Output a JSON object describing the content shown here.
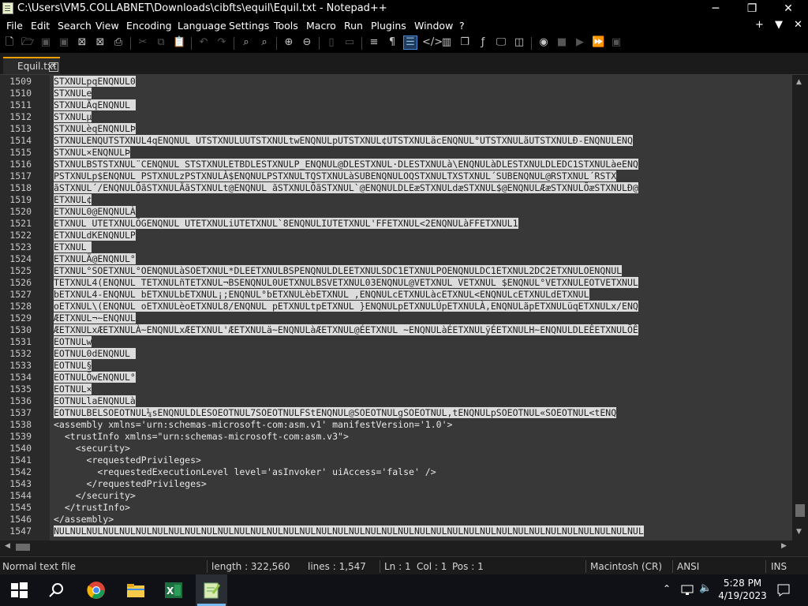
{
  "window": {
    "title": "C:\\Users\\VM5.COLLABNET\\Downloads\\cibfts\\equil\\Equil.txt - Notepad++",
    "buttons": {
      "minimize": "─",
      "maximize": "❐",
      "close": "✕"
    }
  },
  "menu": {
    "items": [
      "File",
      "Edit",
      "Search",
      "View",
      "Encoding",
      "Language",
      "Settings",
      "Tools",
      "Macro",
      "Run",
      "Plugins",
      "Window",
      "?"
    ],
    "right": [
      "+",
      "▼",
      "✕"
    ]
  },
  "toolbar": {
    "icons": [
      "new-file-icon",
      "open-file-icon",
      "save-icon",
      "save-all-icon",
      "close-icon",
      "close-all-icon",
      "print-icon",
      "cut-icon",
      "copy-icon",
      "paste-icon",
      "undo-icon",
      "redo-icon",
      "find-icon",
      "replace-icon",
      "zoom-in-icon",
      "zoom-out-icon",
      "sync-vertical-icon",
      "sync-horizontal-icon",
      "word-wrap-icon",
      "show-all-chars-icon",
      "indent-guide-icon",
      "xml-tag-icon",
      "doc-map-icon",
      "clone-doc-icon",
      "function-list-icon",
      "monitor-icon",
      "folder-workspace-icon",
      "record-macro-icon",
      "stop-macro-icon",
      "play-macro-icon",
      "run-macro-multiple-icon",
      "save-macro-icon"
    ]
  },
  "tabs": [
    {
      "label": "Equil.txt",
      "close": "✕"
    }
  ],
  "editor": {
    "lines": [
      {
        "num": "1509",
        "segments": [
          {
            "t": "STXNULpqENQNUL0",
            "b": true
          }
        ]
      },
      {
        "num": "1510",
        "segments": [
          {
            "t": "STXNULe",
            "b": true
          }
        ]
      },
      {
        "num": "1511",
        "segments": [
          {
            "t": "STXNULÄqENQNUL ",
            "b": true
          }
        ]
      },
      {
        "num": "1512",
        "segments": [
          {
            "t": "STXNULµ",
            "b": true
          }
        ]
      },
      {
        "num": "1513",
        "segments": [
          {
            "t": "STXNULèqENQNULÞ",
            "b": true
          }
        ]
      },
      {
        "num": "1514",
        "segments": [
          {
            "t": "STXNULENQUTSTXNUL4qENQNUL UTSTXNULUUTSTXNULtwENQNULpUTSTXNUL¢UTSTXNULäcENQNUL°UTSTXNULãUTSTXNULÐ-ENQNULENQ",
            "b": true
          }
        ]
      },
      {
        "num": "1515",
        "segments": [
          {
            "t": "STXNUL×ENQNULÞ",
            "b": true
          }
        ]
      },
      {
        "num": "1516",
        "segments": [
          {
            "t": "STXNULBSTSTXNUL¨CENQNUL STSTXNULETBDLESTXNULP_ENQNUL@DLESTXNUL·DLESTXNULà\\ENQNULàDLESTXNULDLEDC1STXNULàeENQ",
            "b": true
          }
        ]
      },
      {
        "num": "1517",
        "segments": [
          {
            "t": "PSTXNULp$ENQNUL PSTXNULzPSTXNULÀ$ENQNULPSTXNULTQSTXNULàSUBENQNULOQSTXNULTXSTXNUL´SUBENQNUL@RSTXNUL´RSTX",
            "b": true
          }
        ]
      },
      {
        "num": "1518",
        "segments": [
          {
            "t": "ãSTXNUL´/ENQNULÕãSTXNULÃãSTXNULt@ENQNUL ãSTXNULÕãSTXNUL`@ENQNULDLEæSTXNULdæSTXNUL$@ENQNULÆæSTXNULÕæSTXNULÐ@",
            "b": true
          }
        ]
      },
      {
        "num": "1519",
        "segments": [
          {
            "t": "ETXNUL¢",
            "b": true
          }
        ]
      },
      {
        "num": "1520",
        "segments": [
          {
            "t": "ETXNUL0@ENQNULÀ",
            "b": true
          }
        ]
      },
      {
        "num": "1521",
        "segments": [
          {
            "t": "ETXNUL UTETXNULÕGENQNUL UTETXNULiUTETXNUL`8ENQNULIUTETXNUL'FFETXNUL<2ENQNULàFFETXNUL1",
            "b": true
          }
        ]
      },
      {
        "num": "1522",
        "segments": [
          {
            "t": "ETXNULdKENQNULP",
            "b": true
          }
        ]
      },
      {
        "num": "1523",
        "segments": [
          {
            "t": "ETXNUL ",
            "b": true
          }
        ]
      },
      {
        "num": "1524",
        "segments": [
          {
            "t": "ETXNULÄ@ENQNUL°",
            "b": true
          }
        ]
      },
      {
        "num": "1525",
        "segments": [
          {
            "t": "ETXNUL°SOETXNUL°OENQNULàSOETXNUL*DLEETXNULBSPENQNULDLEETXNULSDC1ETXNULPOENQNULDC1ETXNUL2DC2ETXNULOENQNUL",
            "b": true
          }
        ]
      },
      {
        "num": "1526",
        "segments": [
          {
            "t": "TETXNUL4(ENQNUL TETXNULñTETXNUL¬BSENQNUL0UETXNULBSVETXNUL03ENQNUL@VETXNUL VETXNUL $ENQNUL°VETXNULEOTVETXNUL",
            "b": true
          }
        ]
      },
      {
        "num": "1527",
        "segments": [
          {
            "t": "bETXNUL4-ENQNUL bETXNULbETXNUL¡;ENQNUL°bETXNULèbETXNUL ,ENQNULcETXNULàcETXNUL<ENQNULcETXNULdETXNUL",
            "b": true
          }
        ]
      },
      {
        "num": "1528",
        "segments": [
          {
            "t": "oETXNUL\\(ENQNUL oETXNULèoETXNUL8/ENQNUL pETXNULtpETXNUL }ENQNULpETXNULÚpETXNULÀ,ENQNULãpETXNULüqETXNULx/ENQ",
            "b": true
          }
        ]
      },
      {
        "num": "1529",
        "segments": [
          {
            "t": "ÆETXNUL¬~ENQNUL",
            "b": true
          }
        ]
      },
      {
        "num": "1530",
        "segments": [
          {
            "t": "ÆETXNULxÆETXNULÀ~ENQNULxÆETXNUL'ÆETXNULä~ENQNULàÆETXNUL@ÉETXNUL ~ENQNULàÉETXNULÿÉETXNULH~ENQNULDLEÊETXNULÕÊ",
            "b": true
          }
        ]
      },
      {
        "num": "1531",
        "segments": [
          {
            "t": "EOTNULw",
            "b": true
          }
        ]
      },
      {
        "num": "1532",
        "segments": [
          {
            "t": "EOTNUL0dENQNUL ",
            "b": true
          }
        ]
      },
      {
        "num": "1533",
        "segments": [
          {
            "t": "EOTNUL§",
            "b": true
          }
        ]
      },
      {
        "num": "1534",
        "segments": [
          {
            "t": "EOTNULÕwENQNUL°",
            "b": true
          }
        ]
      },
      {
        "num": "1535",
        "segments": [
          {
            "t": "EOTNUL×",
            "b": true
          }
        ]
      },
      {
        "num": "1536",
        "segments": [
          {
            "t": "EOTNULlaENQNULà",
            "b": true
          }
        ]
      },
      {
        "num": "1537",
        "segments": [
          {
            "t": "EOTNULBELSOEOTNUL¼sENQNULDLESOEOTNUL7SOEOTNULFStENQNUL@SOEOTNULgSOEOTNUL,tENQNULpSOEOTNUL«SOEOTNUL<tENQ",
            "b": true
          }
        ]
      },
      {
        "num": "1538",
        "segments": [
          {
            "t": "<assembly xmlns='urn:schemas-microsoft-com:asm.v1' manifestVersion='1.0'>",
            "b": false
          }
        ]
      },
      {
        "num": "1539",
        "segments": [
          {
            "t": "  <trustInfo xmlns=\"urn:schemas-microsoft-com:asm.v3\">",
            "b": false
          }
        ]
      },
      {
        "num": "1540",
        "segments": [
          {
            "t": "    <security>",
            "b": false
          }
        ]
      },
      {
        "num": "1541",
        "segments": [
          {
            "t": "      <requestedPrivileges>",
            "b": false
          }
        ]
      },
      {
        "num": "1542",
        "segments": [
          {
            "t": "        <requestedExecutionLevel level='asInvoker' uiAccess='false' />",
            "b": false
          }
        ]
      },
      {
        "num": "1543",
        "segments": [
          {
            "t": "      </requestedPrivileges>",
            "b": false
          }
        ]
      },
      {
        "num": "1544",
        "segments": [
          {
            "t": "    </security>",
            "b": false
          }
        ]
      },
      {
        "num": "1545",
        "segments": [
          {
            "t": "  </trustInfo>",
            "b": false
          }
        ]
      },
      {
        "num": "1546",
        "segments": [
          {
            "t": "</assembly>",
            "b": false
          }
        ]
      },
      {
        "num": "1547",
        "segments": [
          {
            "t": "NULNULNULNULNULNULNULNULNULNULNULNULNULNULNULNULNULNULNULNULNULNULNULNULNULNULNULNULNULNULNULNULNULNULNULNUL",
            "b": true
          }
        ]
      }
    ]
  },
  "status": {
    "file_type": "Normal text file",
    "length": "length : 322,560",
    "lines": "lines : 1,547",
    "ln": "Ln : 1",
    "col": "Col : 1",
    "pos": "Pos : 1",
    "eol": "Macintosh (CR)",
    "encoding": "ANSI",
    "mode": "INS"
  },
  "taskbar": {
    "time": "5:28 PM",
    "date": "4/19/2023",
    "icons": [
      "start-icon",
      "search-icon",
      "chrome-icon",
      "file-explorer-icon",
      "excel-icon",
      "notepadpp-icon"
    ]
  }
}
